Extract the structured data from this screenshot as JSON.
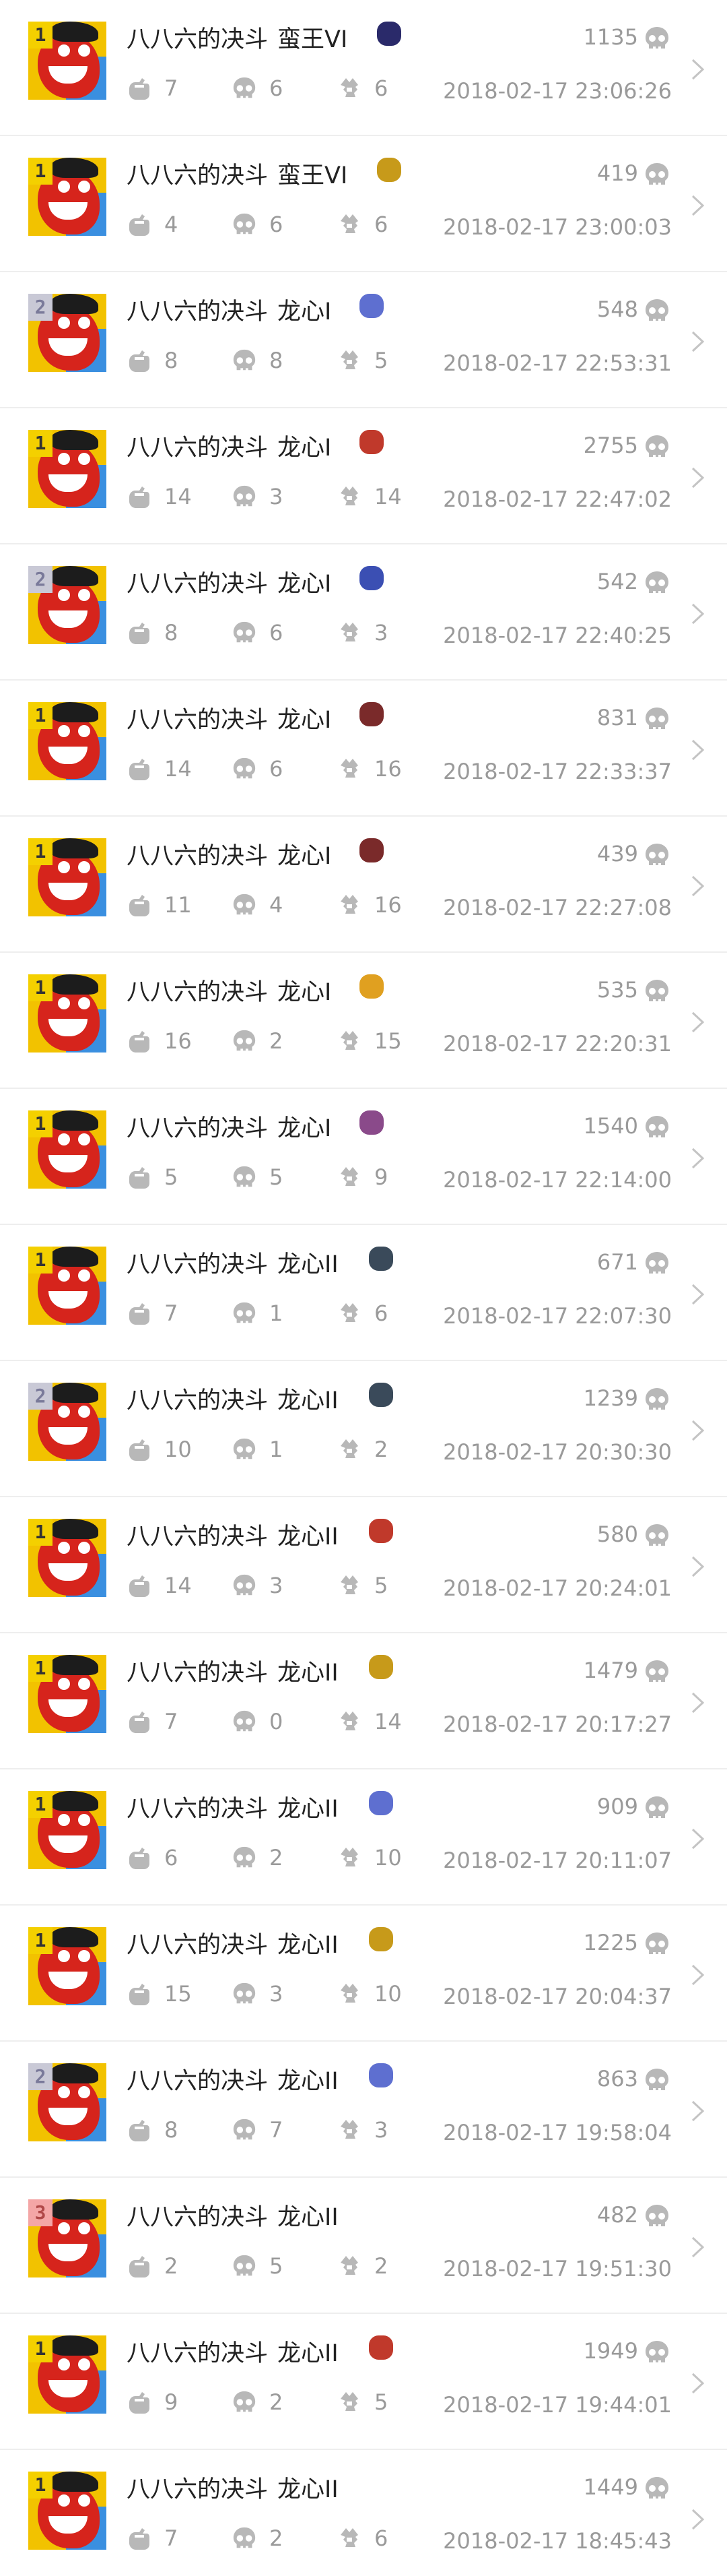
{
  "colors": {
    "text": "#222222",
    "muted": "#9a9a9a",
    "divider": "#eeeeee",
    "icon": "#b8b8b8"
  },
  "icons": {
    "skull": "skull-icon",
    "kills": "sword-hand-icon",
    "deaths": "skull-icon",
    "assists": "paw-icon",
    "chevron": "chevron-right-icon"
  },
  "matches": [
    {
      "rank": "1",
      "mode": "八八六的决斗",
      "tier": "蛮王VI",
      "hero_color": "#2a2a6a",
      "score": "1135",
      "kills": "7",
      "deaths": "6",
      "assists": "6",
      "time": "2018-02-17 23:06:26"
    },
    {
      "rank": "1",
      "mode": "八八六的决斗",
      "tier": "蛮王VI",
      "hero_color": "#c79a1a",
      "score": "419",
      "kills": "4",
      "deaths": "6",
      "assists": "6",
      "time": "2018-02-17 23:00:03"
    },
    {
      "rank": "2",
      "mode": "八八六的决斗",
      "tier": "龙心I",
      "hero_color": "#5e6fd0",
      "score": "548",
      "kills": "8",
      "deaths": "8",
      "assists": "5",
      "time": "2018-02-17 22:53:31"
    },
    {
      "rank": "1",
      "mode": "八八六的决斗",
      "tier": "龙心I",
      "hero_color": "#c0392b",
      "score": "2755",
      "kills": "14",
      "deaths": "3",
      "assists": "14",
      "time": "2018-02-17 22:47:02"
    },
    {
      "rank": "2",
      "mode": "八八六的决斗",
      "tier": "龙心I",
      "hero_color": "#3b4fb3",
      "score": "542",
      "kills": "8",
      "deaths": "6",
      "assists": "3",
      "time": "2018-02-17 22:40:25"
    },
    {
      "rank": "1",
      "mode": "八八六的决斗",
      "tier": "龙心I",
      "hero_color": "#7a2a2a",
      "score": "831",
      "kills": "14",
      "deaths": "6",
      "assists": "16",
      "time": "2018-02-17 22:33:37"
    },
    {
      "rank": "1",
      "mode": "八八六的决斗",
      "tier": "龙心I",
      "hero_color": "#7a2a2a",
      "score": "439",
      "kills": "11",
      "deaths": "4",
      "assists": "16",
      "time": "2018-02-17 22:27:08"
    },
    {
      "rank": "1",
      "mode": "八八六的决斗",
      "tier": "龙心I",
      "hero_color": "#e0a020",
      "score": "535",
      "kills": "16",
      "deaths": "2",
      "assists": "15",
      "time": "2018-02-17 22:20:31"
    },
    {
      "rank": "1",
      "mode": "八八六的决斗",
      "tier": "龙心I",
      "hero_color": "#8a4a8a",
      "score": "1540",
      "kills": "5",
      "deaths": "5",
      "assists": "9",
      "time": "2018-02-17 22:14:00"
    },
    {
      "rank": "1",
      "mode": "八八六的决斗",
      "tier": "龙心II",
      "hero_color": "#3a4a5a",
      "score": "671",
      "kills": "7",
      "deaths": "1",
      "assists": "6",
      "time": "2018-02-17 22:07:30"
    },
    {
      "rank": "2",
      "mode": "八八六的决斗",
      "tier": "龙心II",
      "hero_color": "#3a4a5a",
      "score": "1239",
      "kills": "10",
      "deaths": "1",
      "assists": "2",
      "time": "2018-02-17 20:30:30"
    },
    {
      "rank": "1",
      "mode": "八八六的决斗",
      "tier": "龙心II",
      "hero_color": "#c0392b",
      "score": "580",
      "kills": "14",
      "deaths": "3",
      "assists": "5",
      "time": "2018-02-17 20:24:01"
    },
    {
      "rank": "1",
      "mode": "八八六的决斗",
      "tier": "龙心II",
      "hero_color": "#c79a1a",
      "score": "1479",
      "kills": "7",
      "deaths": "0",
      "assists": "14",
      "time": "2018-02-17 20:17:27"
    },
    {
      "rank": "1",
      "mode": "八八六的决斗",
      "tier": "龙心II",
      "hero_color": "#5e6fd0",
      "score": "909",
      "kills": "6",
      "deaths": "2",
      "assists": "10",
      "time": "2018-02-17 20:11:07"
    },
    {
      "rank": "1",
      "mode": "八八六的决斗",
      "tier": "龙心II",
      "hero_color": "#c79a1a",
      "score": "1225",
      "kills": "15",
      "deaths": "3",
      "assists": "10",
      "time": "2018-02-17 20:04:37"
    },
    {
      "rank": "2",
      "mode": "八八六的决斗",
      "tier": "龙心II",
      "hero_color": "#5e6fd0",
      "score": "863",
      "kills": "8",
      "deaths": "7",
      "assists": "3",
      "time": "2018-02-17 19:58:04"
    },
    {
      "rank": "3",
      "mode": "八八六的决斗",
      "tier": "龙心II",
      "hero_color": "",
      "score": "482",
      "kills": "2",
      "deaths": "5",
      "assists": "2",
      "time": "2018-02-17 19:51:30"
    },
    {
      "rank": "1",
      "mode": "八八六的决斗",
      "tier": "龙心II",
      "hero_color": "#c0392b",
      "score": "1949",
      "kills": "9",
      "deaths": "2",
      "assists": "5",
      "time": "2018-02-17 19:44:01"
    },
    {
      "rank": "1",
      "mode": "八八六的决斗",
      "tier": "龙心II",
      "hero_color": "",
      "score": "1449",
      "kills": "7",
      "deaths": "2",
      "assists": "6",
      "time": "2018-02-17 18:45:43"
    }
  ]
}
